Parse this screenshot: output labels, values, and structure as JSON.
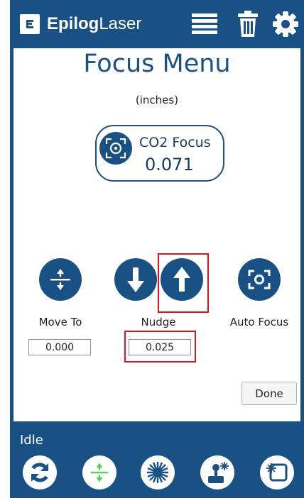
{
  "header": {
    "brand_bold": "Epilog",
    "brand_light": "Laser",
    "icons": [
      "job-list-icon",
      "trash-icon",
      "gear-icon"
    ]
  },
  "focus_menu": {
    "title": "Focus Menu",
    "units": "(inches)",
    "co2_focus": {
      "label": "CO2 Focus",
      "value": "0.071",
      "icon": "focus-target-icon"
    },
    "move_to": {
      "label": "Move To",
      "value": "0.000",
      "icon": "move-to-icon"
    },
    "nudge": {
      "label": "Nudge",
      "value": "0.025",
      "down_icon": "arrow-down-icon",
      "up_icon": "arrow-up-icon"
    },
    "auto_focus": {
      "label": "Auto Focus",
      "icon": "auto-focus-icon"
    },
    "done_label": "Done"
  },
  "status": {
    "text": "Idle"
  },
  "toolbar": {
    "items": [
      {
        "name": "refresh",
        "icon": "refresh-icon"
      },
      {
        "name": "focus",
        "icon": "focus-icon",
        "active": true
      },
      {
        "name": "laser",
        "icon": "laser-burst-icon"
      },
      {
        "name": "joystick",
        "icon": "joystick-icon"
      },
      {
        "name": "frame",
        "icon": "frame-icon"
      }
    ]
  },
  "colors": {
    "brand_blue": "#1a5184",
    "highlight_red": "#e0141e",
    "active_green": "#3ddc3d"
  }
}
